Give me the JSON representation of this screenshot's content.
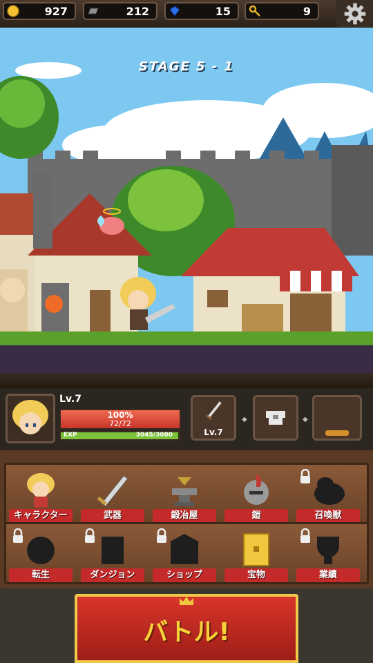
{
  "resources": [
    {
      "icon": "gold-coin-icon",
      "value": "927"
    },
    {
      "icon": "iron-ingot-icon",
      "value": "212"
    },
    {
      "icon": "blue-gem-icon",
      "value": "15"
    },
    {
      "icon": "key-icon",
      "value": "9"
    }
  ],
  "stage": "STAGE 5 - 1",
  "character": {
    "level": "Lv.7",
    "hp_percent": "100%",
    "hp": "72/72",
    "hp_fraction": 1.0,
    "exp_label": "EXP",
    "exp": "3045/3080",
    "exp_fraction": 0.989
  },
  "equipment": {
    "weapon_level": "Lv.7"
  },
  "menu": [
    {
      "label": "キャラクター",
      "locked": false
    },
    {
      "label": "武器",
      "locked": false
    },
    {
      "label": "鍛冶屋",
      "locked": false
    },
    {
      "label": "鎧",
      "locked": false
    },
    {
      "label": "召喚獣",
      "locked": true
    },
    {
      "label": "転生",
      "locked": true
    },
    {
      "label": "ダンジョン",
      "locked": true
    },
    {
      "label": "ショップ",
      "locked": true
    },
    {
      "label": "宝物",
      "locked": false
    },
    {
      "label": "業績",
      "locked": true
    }
  ],
  "battle_button": "バトル!",
  "colors": {
    "hp": "#e24a3a",
    "exp": "#7cc23a",
    "menu_label": "#c42a2a",
    "battle": "#d8352a",
    "battle_text": "#f6d23a"
  }
}
